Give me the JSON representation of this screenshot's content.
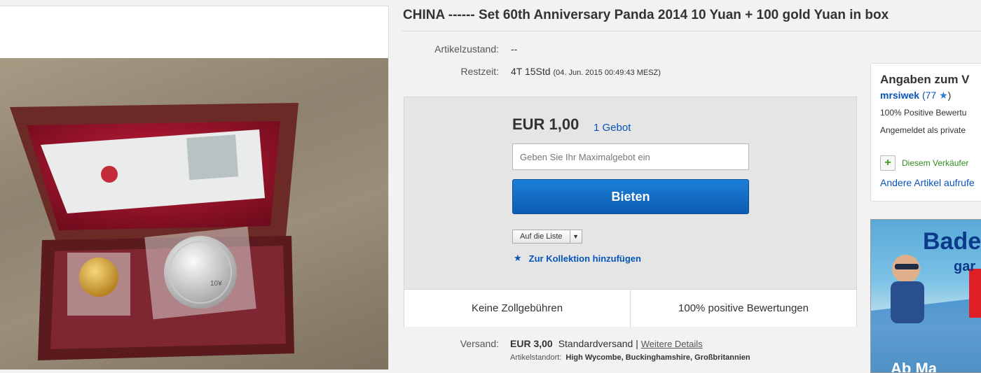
{
  "listing": {
    "title": "CHINA ------ Set 60th Anniversary Panda 2014 10 Yuan + 100 gold Yuan in box",
    "condition_label": "Artikelzustand:",
    "condition_value": "--",
    "time_label": "Restzeit:",
    "time_value": "4T 15Std",
    "time_end": "(04. Jun. 2015   00:49:43 MESZ)"
  },
  "bid": {
    "price": "EUR 1,00",
    "bids_count": "1 Gebot",
    "max_bid_placeholder": "Geben Sie Ihr Maximalgebot ein",
    "bid_button": "Bieten",
    "watch_label": "Auf die Liste",
    "collection_label": "Zur Kollektion hinzufügen",
    "footer_left": "Keine Zollgebühren",
    "footer_right": "100% positive Bewertungen"
  },
  "shipping": {
    "label": "Versand:",
    "cost": "EUR 3,00",
    "method": "Standardversand |",
    "details_link": "Weitere Details",
    "location_label": "Artikelstandort:",
    "location_value": "High Wycombe, Buckinghamshire, Großbritannien"
  },
  "seller": {
    "heading": "Angaben zum V",
    "name": "mrsiwek",
    "rating_count": "(77",
    "rating_close": ")",
    "positive": "100% Positive Bewertu",
    "registered": "Angemeldet als private",
    "follow": "Diesem Verkäufer",
    "other_items": "Andere Artikel aufrufe"
  },
  "ad": {
    "brand": "Bade",
    "sub": "gar",
    "bottom": "Ab Ma"
  },
  "photo": {
    "seal_text": "10¥"
  },
  "colors": {
    "link": "#0654ba",
    "bid_button": "#0b5cb0",
    "follow_green": "#2e8a1e",
    "box_maroon": "#5a1a1e"
  }
}
